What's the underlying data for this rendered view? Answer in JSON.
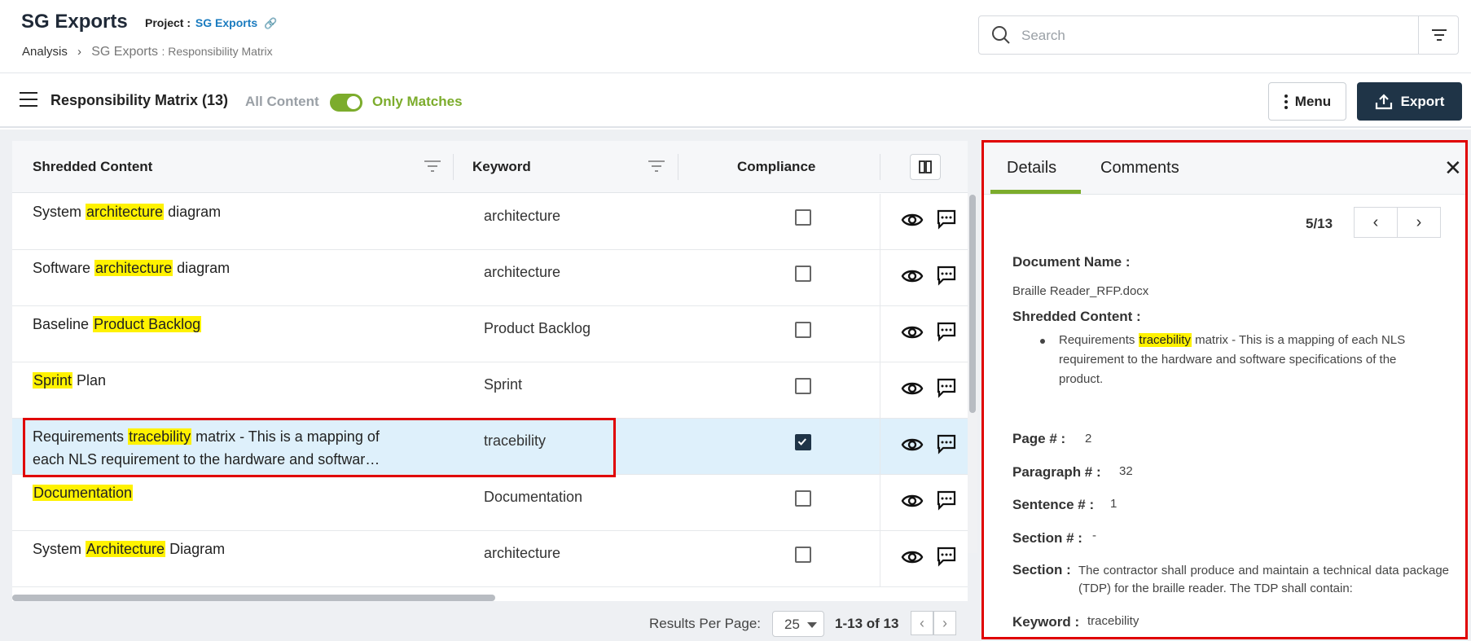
{
  "header": {
    "app_title": "SG Exports",
    "project_label": "Project :",
    "project_link": "SG Exports",
    "breadcrumb_root": "Analysis",
    "breadcrumb_current": "SG Exports",
    "breadcrumb_current_sub": ": Responsibility Matrix"
  },
  "search": {
    "placeholder": "Search",
    "value": ""
  },
  "toolbar": {
    "title": "Responsibility Matrix (13)",
    "all_content_label": "All Content",
    "only_matches_label": "Only Matches",
    "toggle_on": true,
    "menu_label": "Menu",
    "export_label": "Export"
  },
  "table": {
    "columns": [
      "Shredded Content",
      "Keyword",
      "Compliance"
    ],
    "rows": [
      {
        "pre": "System ",
        "hl": "architecture",
        "post": " diagram",
        "keyword": "architecture",
        "compliance": false
      },
      {
        "pre": "Software ",
        "hl": "architecture",
        "post": " diagram",
        "keyword": "architecture",
        "compliance": false
      },
      {
        "pre": "Baseline ",
        "hl": "Product Backlog",
        "post": "",
        "keyword": "Product Backlog",
        "compliance": false
      },
      {
        "pre": "",
        "hl": "Sprint",
        "post": " Plan",
        "keyword": "Sprint",
        "compliance": false
      },
      {
        "pre": "Requirements ",
        "hl": "tracebility",
        "post": " matrix - This is a mapping of each NLS requirement to the hardware and softwar…",
        "keyword": "tracebility",
        "compliance": true,
        "selected": true
      },
      {
        "pre": "",
        "hl": "Documentation",
        "post": "",
        "keyword": "Documentation",
        "compliance": false
      },
      {
        "pre": "System ",
        "hl": "Architecture",
        "post": " Diagram",
        "keyword": "architecture",
        "compliance": false
      }
    ]
  },
  "footer": {
    "results_per_page_label": "Results Per Page:",
    "results_per_page_value": "25",
    "range": "1-13 of 13"
  },
  "details": {
    "tab_details": "Details",
    "tab_comments": "Comments",
    "pager": "5/13",
    "document_name_label": "Document Name :",
    "document_name": "Braille Reader_RFP.docx",
    "shredded_label": "Shredded Content :",
    "shredded_pre": "Requirements ",
    "shredded_hl": "tracebility",
    "shredded_post": " matrix - This is a mapping of each NLS requirement to the hardware and software specifications of the product.",
    "page_label": "Page # :",
    "page_value": "2",
    "paragraph_label": "Paragraph # :",
    "paragraph_value": "32",
    "sentence_label": "Sentence # :",
    "sentence_value": "1",
    "section_num_label": "Section # :",
    "section_num_value": "-",
    "section_label": "Section :",
    "section_value": "The contractor shall produce and maintain a technical data package (TDP) for the braille reader. The TDP shall contain:",
    "keyword_label": "Keyword :",
    "keyword_value": "tracebility"
  },
  "colors": {
    "accent_green": "#7cac2c",
    "dark_navy": "#1f3447",
    "highlight": "#fff200",
    "selected_row": "#def0fb",
    "annotation_red": "#e00000"
  }
}
